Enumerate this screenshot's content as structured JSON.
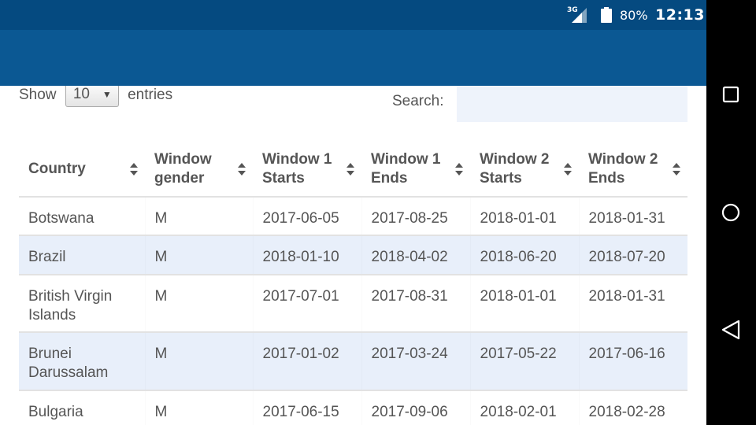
{
  "status_bar": {
    "network": "3G",
    "battery": "80%",
    "time": "12:13"
  },
  "length_control": {
    "show_label": "Show",
    "selected": "10",
    "entries_label": "entries"
  },
  "search": {
    "label": "Search:",
    "value": "",
    "placeholder": ""
  },
  "table": {
    "columns": [
      {
        "line1": "Country",
        "line2": ""
      },
      {
        "line1": "Window",
        "line2": "gender"
      },
      {
        "line1": "Window 1",
        "line2": "Starts"
      },
      {
        "line1": "Window 1",
        "line2": "Ends"
      },
      {
        "line1": "Window 2",
        "line2": "Starts"
      },
      {
        "line1": "Window 2",
        "line2": "Ends"
      }
    ],
    "rows": [
      [
        "Botswana",
        "M",
        "2017-06-05",
        "2017-08-25",
        "2018-01-01",
        "2018-01-31"
      ],
      [
        "Brazil",
        "M",
        "2018-01-10",
        "2018-04-02",
        "2018-06-20",
        "2018-07-20"
      ],
      [
        "British Virgin Islands",
        "M",
        "2017-07-01",
        "2017-08-31",
        "2018-01-01",
        "2018-01-31"
      ],
      [
        "Brunei Darussalam",
        "M",
        "2017-01-02",
        "2017-03-24",
        "2017-05-22",
        "2017-06-16"
      ],
      [
        "Bulgaria",
        "M",
        "2017-06-15",
        "2017-09-06",
        "2018-02-01",
        "2018-02-28"
      ]
    ]
  },
  "nav_bar": {
    "buttons": [
      "recents",
      "home",
      "back"
    ]
  },
  "colors": {
    "status_bar": "#054a80",
    "app_bar": "#0b5893",
    "row_stripe": "#e8effa",
    "search_bg": "#eef3fb",
    "text": "#555555"
  }
}
